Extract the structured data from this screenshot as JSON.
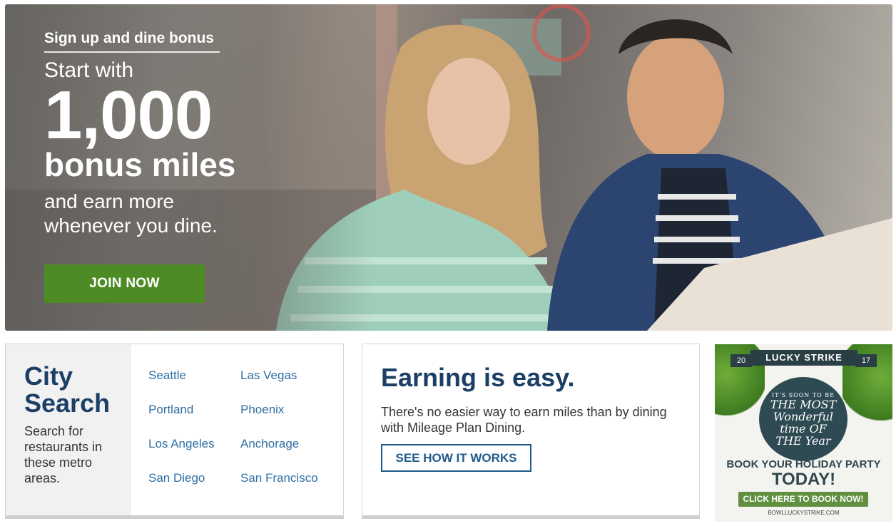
{
  "hero": {
    "kicker": "Sign up and dine bonus",
    "lead": "Start with",
    "number": "1,000",
    "miles": "bonus miles",
    "tail_line1": "and earn more",
    "tail_line2": "whenever you dine.",
    "join_label": "JOIN NOW",
    "join_color": "#4d8b24"
  },
  "city_search": {
    "title_line1": "City",
    "title_line2": "Search",
    "description": "Search for restaurants in these metro areas.",
    "cities": [
      "Seattle",
      "Las Vegas",
      "Portland",
      "Phoenix",
      "Los Angeles",
      "Anchorage",
      "San Diego",
      "San Francisco"
    ]
  },
  "earning": {
    "title": "Earning is easy.",
    "text": "There's no easier way to earn miles than by dining with Mileage Plan Dining.",
    "button_label": "SEE HOW IT WORKS"
  },
  "ad": {
    "banner": "LUCKY STRIKE",
    "year_left": "20",
    "year_right": "17",
    "badge_small": "IT'S SOON TO BE",
    "badge_line1": "THE MOST",
    "badge_line2": "Wonderful",
    "badge_line3": "time OF",
    "badge_line4": "THE Year",
    "cta": "BOOK YOUR HOLIDAY PARTY",
    "today": "TODAY!",
    "click": "CLICK HERE TO BOOK NOW!",
    "url": "BOWLLUCKYSTRIKE.COM"
  },
  "colors": {
    "navy": "#1b3f66",
    "link": "#2f6fa4",
    "green": "#4d8b24"
  }
}
